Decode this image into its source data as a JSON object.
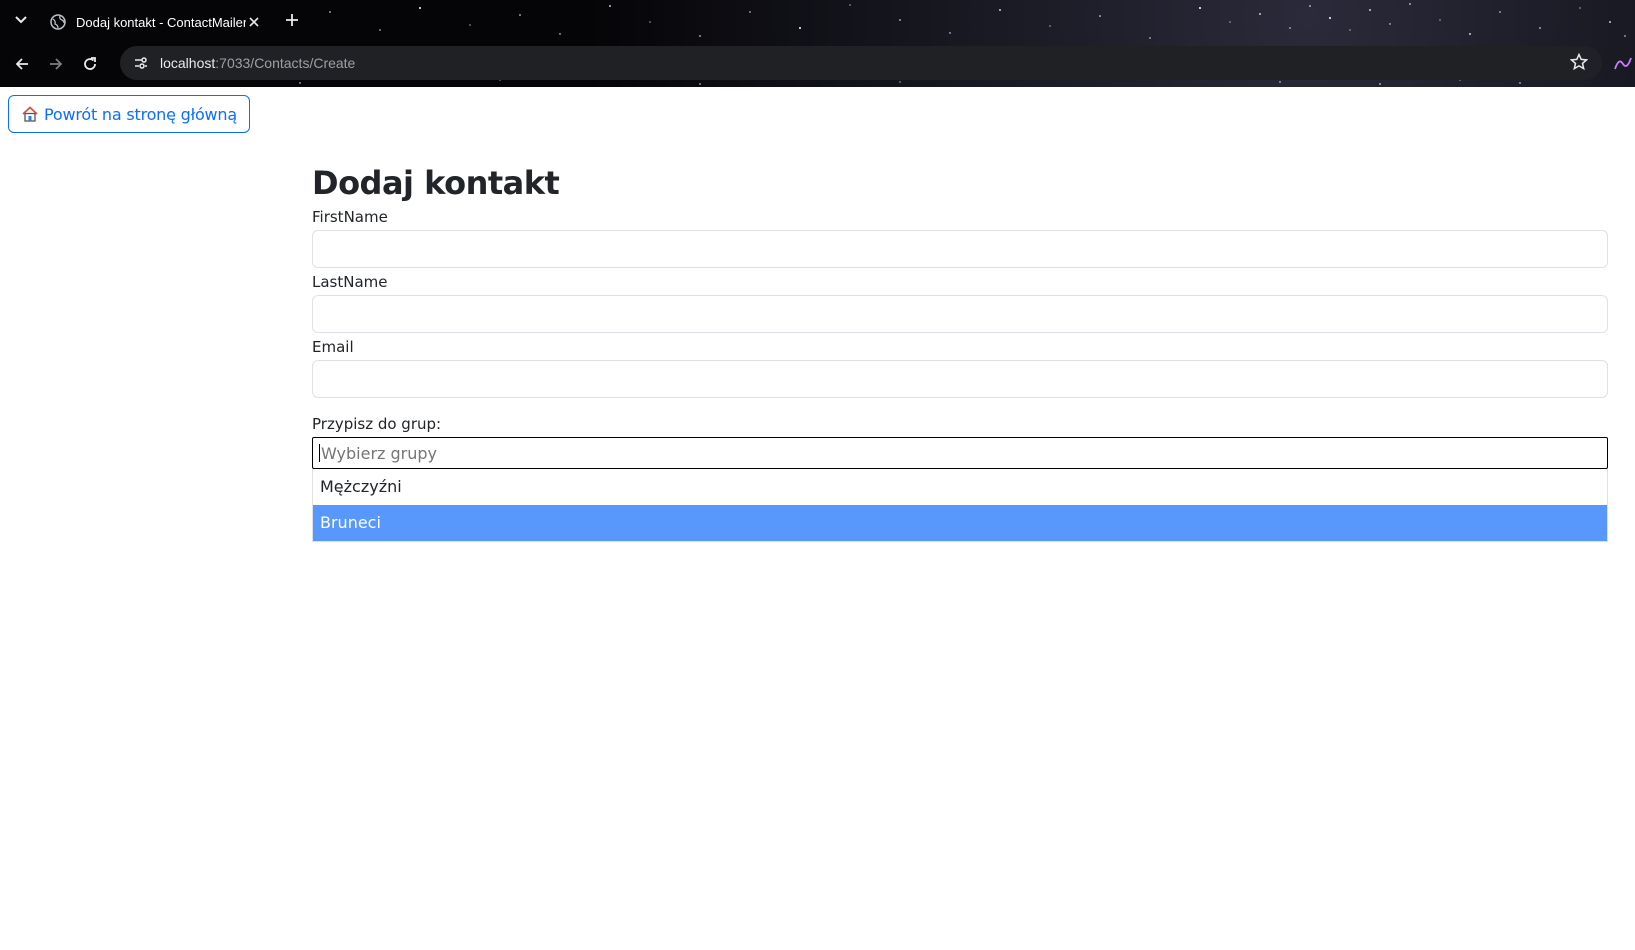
{
  "browser": {
    "tab_title": "Dodaj kontakt - ContactMailer",
    "url_host": "localhost",
    "url_path": ":7033/Contacts/Create"
  },
  "page": {
    "home_button_label": "Powrót na stronę główną",
    "title": "Dodaj kontakt",
    "fields": {
      "first_name_label": "FirstName",
      "first_name_value": "",
      "last_name_label": "LastName",
      "last_name_value": "",
      "email_label": "Email",
      "email_value": ""
    },
    "groups": {
      "label": "Przypisz do grup:",
      "placeholder": "Wybierz grupy",
      "options": [
        "Mężczyźni",
        "Bruneci"
      ],
      "highlighted_option": "Bruneci"
    }
  },
  "colors": {
    "primary": "#0d6efd",
    "highlight": "#5897fb"
  }
}
